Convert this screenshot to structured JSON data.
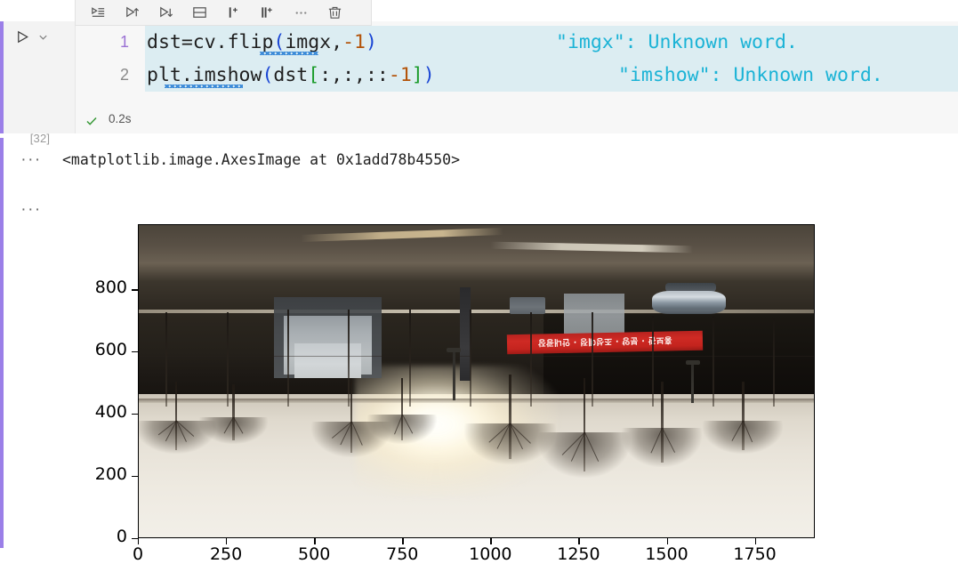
{
  "toolbar": {
    "buttons": [
      {
        "name": "run-by-line-icon",
        "title": "Run by Line"
      },
      {
        "name": "execute-above-cells-icon",
        "title": "Execute Above Cells"
      },
      {
        "name": "execute-cell-below-icon",
        "title": "Execute Cell and Below"
      },
      {
        "name": "split-cell-icon",
        "title": "Split Cell"
      },
      {
        "name": "insert-code-cell-icon",
        "title": "Insert Code Cell"
      },
      {
        "name": "insert-markdown-cell-icon",
        "title": "Insert Markdown Cell"
      },
      {
        "name": "more-actions-icon",
        "title": "More Actions"
      },
      {
        "name": "delete-cell-icon",
        "title": "Delete Cell"
      }
    ]
  },
  "cell": {
    "execution_count": "[32]",
    "run_button_title": "Execute Cell",
    "status_time": "0.2s",
    "status_state": "success",
    "accent_color": "#9b7fe8",
    "code_lines": [
      {
        "number": "1",
        "active": true,
        "tokens": [
          {
            "t": "dst=cv.flip",
            "c": "plain"
          },
          {
            "t": "(",
            "c": "paren"
          },
          {
            "t": "imgx,",
            "c": "plain"
          },
          {
            "t": "-1",
            "c": "num"
          },
          {
            "t": ")",
            "c": "paren"
          }
        ],
        "hint": "\"imgx\": Unknown word.",
        "hint_left": 540
      },
      {
        "number": "2",
        "active": false,
        "tokens": [
          {
            "t": "plt.imshow",
            "c": "plain"
          },
          {
            "t": "(",
            "c": "paren"
          },
          {
            "t": "dst",
            "c": "plain"
          },
          {
            "t": "[",
            "c": "brack"
          },
          {
            "t": ":,:,::",
            "c": "plain"
          },
          {
            "t": "-1",
            "c": "num"
          },
          {
            "t": "]",
            "c": "brack"
          },
          {
            "t": ")",
            "c": "paren"
          }
        ],
        "hint": "\"imshow\": Unknown word.",
        "hint_left": 610
      }
    ]
  },
  "output": {
    "ellipsis_label": "···",
    "repr_text": "<matplotlib.image.AxesImage at 0x1add78b4550>"
  },
  "chart_data": {
    "type": "heatmap",
    "title": "",
    "xlabel": "",
    "ylabel": "",
    "xlim": [
      0,
      1920
    ],
    "ylim": [
      1009,
      0
    ],
    "xticks": [
      0,
      250,
      500,
      750,
      1000,
      1250,
      1500,
      1750
    ],
    "yticks": [
      0,
      200,
      400,
      600,
      800
    ],
    "xtick_labels": [
      "0",
      "250",
      "500",
      "750",
      "1000",
      "1250",
      "1500",
      "1750"
    ],
    "ytick_labels": [
      "0",
      "200",
      "400",
      "600",
      "800"
    ],
    "grid": false,
    "legend": null,
    "description": "Vertically and horizontally flipped (cv.flip flag -1) RGB photograph of an outdoor winter scene with snow-covered ground, bare trees, a chain-link fence, apartment buildings, a bus and a red Korean banner. Displayed with reversed channel order dst[:,:,::-1].",
    "image_shape": [
      1009,
      1920,
      3
    ],
    "banner_text": "홍보관 · 분양 · 조성예정 · 안내광장"
  }
}
